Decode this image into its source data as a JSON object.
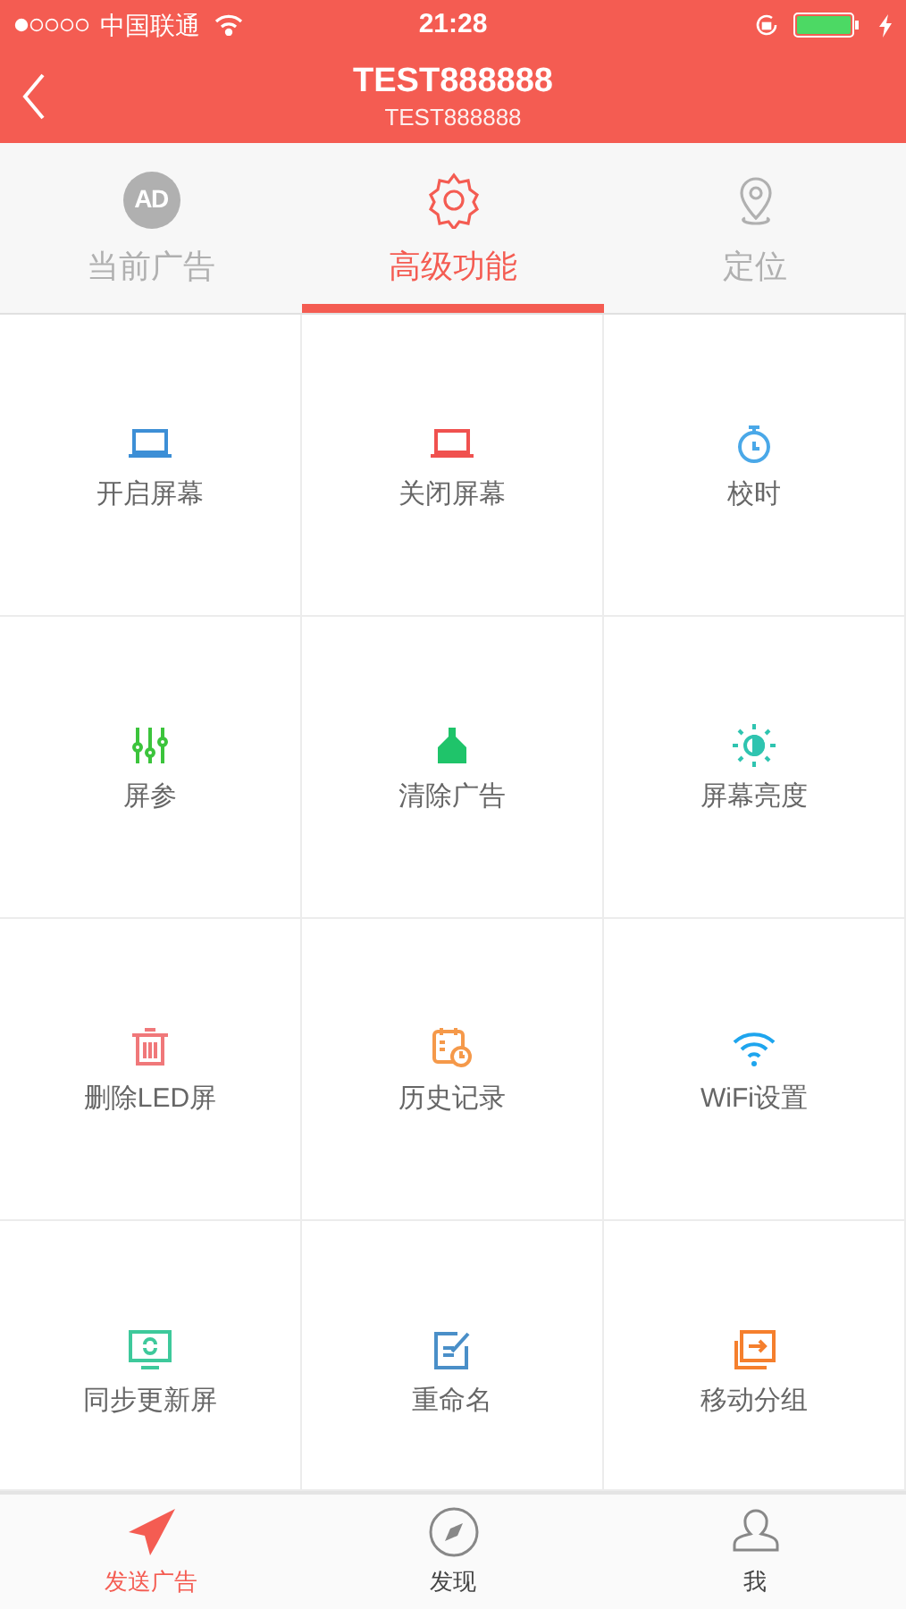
{
  "status_bar": {
    "carrier": "中国联通",
    "time": "21:28"
  },
  "header": {
    "title": "TEST888888",
    "subtitle": "TEST888888"
  },
  "tabs": [
    {
      "label": "当前广告",
      "kind": "badge",
      "badge": "AD",
      "selected": false
    },
    {
      "label": "高级功能",
      "kind": "gear",
      "selected": true
    },
    {
      "label": "定位",
      "kind": "pin",
      "selected": false
    }
  ],
  "functions": [
    {
      "label": "开启屏幕",
      "kind": "laptop",
      "color": "#3d8fd6"
    },
    {
      "label": "关闭屏幕",
      "kind": "laptop",
      "color": "#f0514f"
    },
    {
      "label": "校时",
      "kind": "stopwatch",
      "color": "#4aa8e8"
    },
    {
      "label": "屏参",
      "kind": "sliders",
      "color": "#3cc43c"
    },
    {
      "label": "清除广告",
      "kind": "broom",
      "color": "#1fc46a"
    },
    {
      "label": "屏幕亮度",
      "kind": "brightness",
      "color": "#2fc4b0"
    },
    {
      "label": "删除LED屏",
      "kind": "trash",
      "color": "#f0787a"
    },
    {
      "label": "历史记录",
      "kind": "calendar",
      "color": "#f5994a"
    },
    {
      "label": "WiFi设置",
      "kind": "wifi",
      "color": "#1ea5ee"
    },
    {
      "label": "同步更新屏",
      "kind": "sync",
      "color": "#3ec99b"
    },
    {
      "label": "重命名",
      "kind": "edit",
      "color": "#4a8fc8"
    },
    {
      "label": "移动分组",
      "kind": "move",
      "color": "#f57f2d"
    }
  ],
  "bottom_nav": [
    {
      "label": "发送广告",
      "kind": "plane",
      "selected": true
    },
    {
      "label": "发现",
      "kind": "compass",
      "selected": false
    },
    {
      "label": "我",
      "kind": "person",
      "selected": false
    }
  ]
}
